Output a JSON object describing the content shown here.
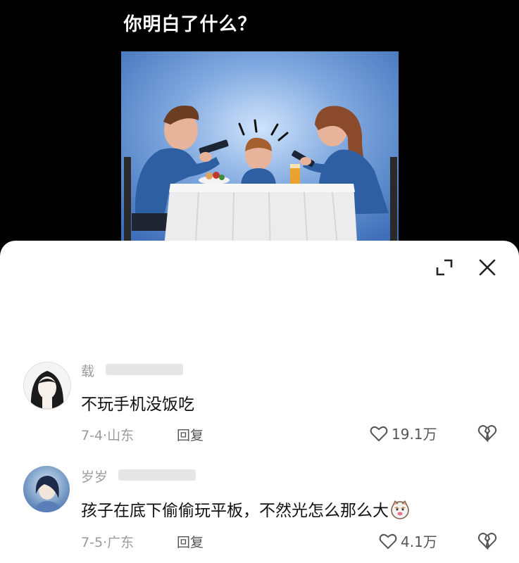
{
  "video": {
    "title": "你明白了什么？"
  },
  "sheet": {
    "expand_icon": "expand-icon",
    "close_icon": "close-icon"
  },
  "comments": [
    {
      "username": "载",
      "text": "不玩手机没饭吃",
      "date": "7-4",
      "location": "山东",
      "reply_label": "回复",
      "likes": "19.1万"
    },
    {
      "username": "岁岁",
      "text": "孩子在底下偷偷玩平板，不然光怎么那么大",
      "emoji": "cat-face-emoji",
      "date": "7-5",
      "location": "广东",
      "reply_label": "回复",
      "likes": "4.1万"
    }
  ],
  "colors": {
    "background": "#000000",
    "sheet": "#ffffff",
    "muted_text": "#9b9b9b",
    "illustration_bg": "#5f8fd0"
  }
}
